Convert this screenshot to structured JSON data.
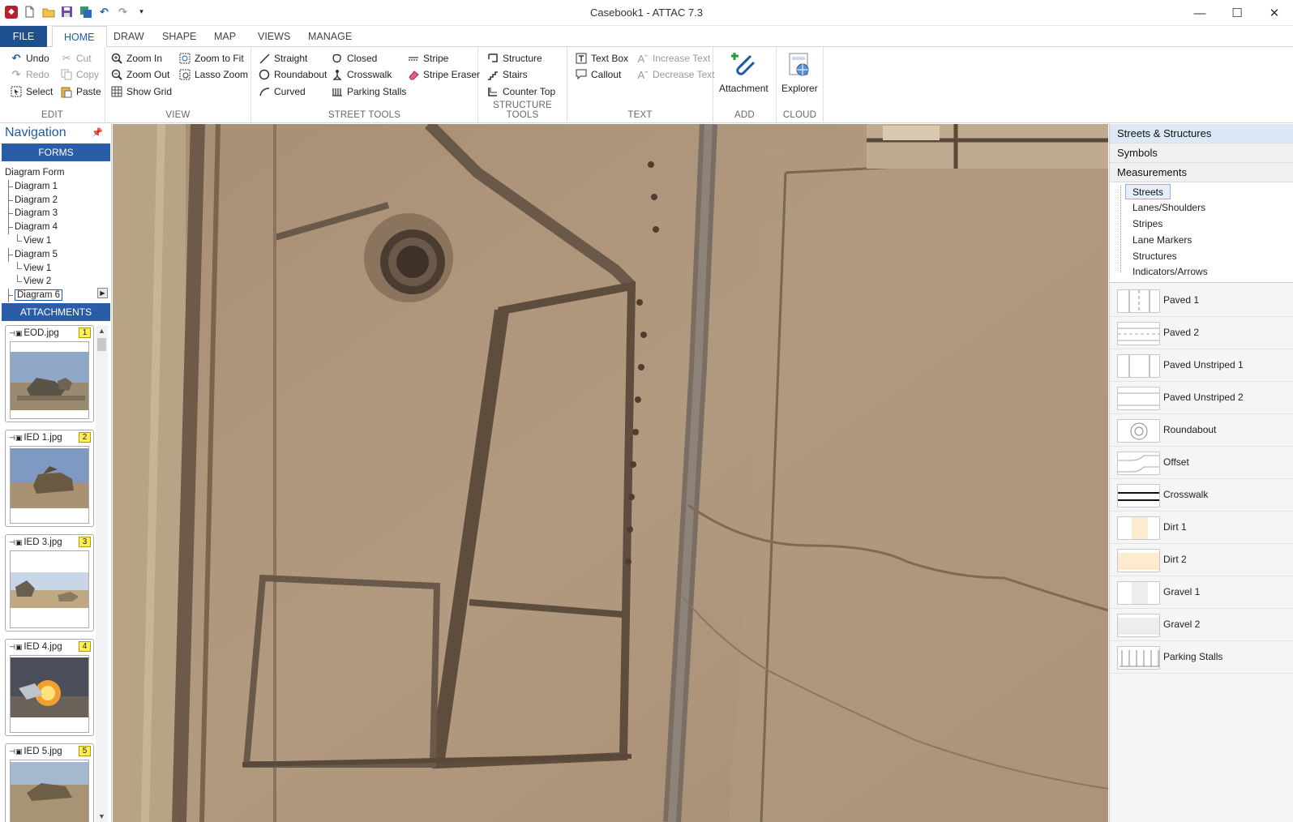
{
  "window": {
    "title": "Casebook1 - ATTAC 7.3",
    "minimize": "—",
    "maximize": "☐",
    "close": "✕"
  },
  "tabs": [
    {
      "label": "FILE"
    },
    {
      "label": "HOME"
    },
    {
      "label": "DRAW"
    },
    {
      "label": "SHAPE"
    },
    {
      "label": "MAP"
    },
    {
      "label": "VIEWS"
    },
    {
      "label": "MANAGE"
    }
  ],
  "ribbon": {
    "edit": {
      "label": "EDIT",
      "undo": "Undo",
      "redo": "Redo",
      "select": "Select",
      "cut": "Cut",
      "copy": "Copy",
      "paste": "Paste"
    },
    "view": {
      "label": "VIEW",
      "zoom_in": "Zoom In",
      "zoom_out": "Zoom Out",
      "show_grid": "Show Grid",
      "zoom_fit": "Zoom to Fit",
      "lasso_zoom": "Lasso Zoom"
    },
    "street": {
      "label": "STREET TOOLS",
      "straight": "Straight",
      "roundabout": "Roundabout",
      "curved": "Curved",
      "closed": "Closed",
      "crosswalk": "Crosswalk",
      "parking": "Parking Stalls",
      "stripe": "Stripe",
      "stripe_eraser": "Stripe Eraser"
    },
    "structure": {
      "label": "STRUCTURE TOOLS",
      "structure": "Structure",
      "stairs": "Stairs",
      "counter_top": "Counter Top"
    },
    "text": {
      "label": "TEXT",
      "text_box": "Text Box",
      "callout": "Callout",
      "increase": "Increase Text",
      "decrease": "Decrease Text"
    },
    "add": {
      "label": "ADD",
      "attachment": "Attachment"
    },
    "cloud": {
      "label": "CLOUD",
      "explorer": "Explorer"
    }
  },
  "navigation": {
    "title": "Navigation",
    "forms_label": "FORMS",
    "attachments_label": "ATTACHMENTS",
    "tree": [
      {
        "label": "Diagram Form",
        "level": 0
      },
      {
        "label": "Diagram 1",
        "level": 1
      },
      {
        "label": "Diagram 2",
        "level": 1
      },
      {
        "label": "Diagram 3",
        "level": 1
      },
      {
        "label": "Diagram 4",
        "level": 1
      },
      {
        "label": "View 1",
        "level": 2
      },
      {
        "label": "Diagram 5",
        "level": 1
      },
      {
        "label": "View 1",
        "level": 2
      },
      {
        "label": "View 2",
        "level": 2
      },
      {
        "label": "Diagram 6",
        "level": 1,
        "selected": true
      }
    ],
    "attachments": [
      {
        "name": "EOD.jpg",
        "num": "1"
      },
      {
        "name": "IED 1.jpg",
        "num": "2"
      },
      {
        "name": "IED 3.jpg",
        "num": "3"
      },
      {
        "name": "IED 4.jpg",
        "num": "4"
      },
      {
        "name": "IED 5.jpg",
        "num": "5"
      }
    ]
  },
  "right_panel": {
    "tabs": [
      "Streets & Structures",
      "Symbols",
      "Measurements"
    ],
    "tree": [
      "Streets",
      "Lanes/Shoulders",
      "Stripes",
      "Lane Markers",
      "Structures",
      "Indicators/Arrows"
    ],
    "symbols": [
      "Paved 1",
      "Paved 2",
      "Paved Unstriped 1",
      "Paved Unstriped 2",
      "Roundabout",
      "Offset",
      "Crosswalk",
      "Dirt 1",
      "Dirt 2",
      "Gravel 1",
      "Gravel 2",
      "Parking Stalls"
    ]
  },
  "colors": {
    "accent": "#1e5aa8",
    "section_bar": "#2b5ca8",
    "map_base": "#a89078"
  }
}
